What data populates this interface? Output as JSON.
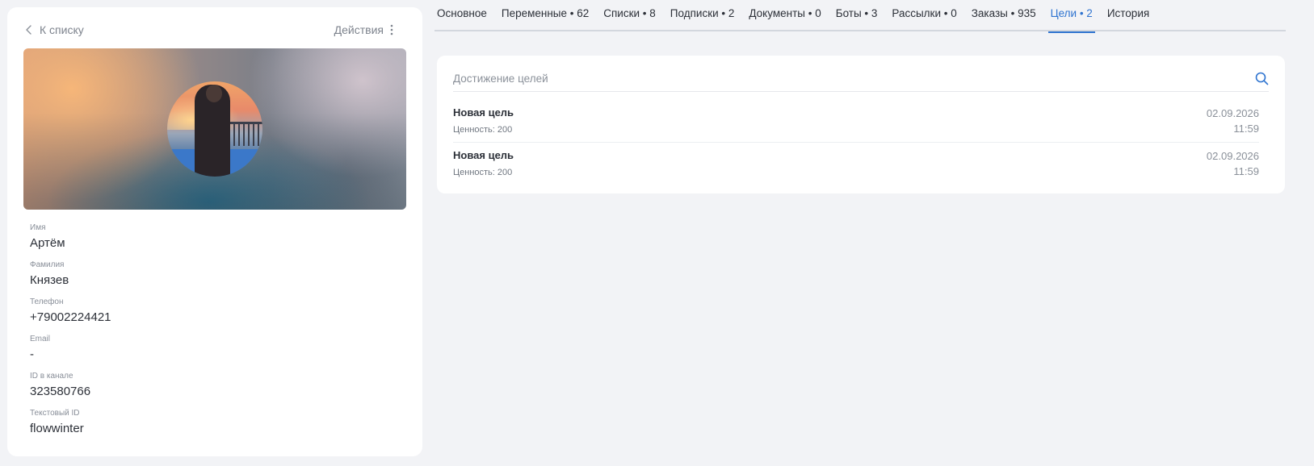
{
  "header": {
    "back_label": "К списку",
    "actions_label": "Действия"
  },
  "profile": {
    "fields": [
      {
        "label": "Имя",
        "value": "Артём"
      },
      {
        "label": "Фамилия",
        "value": "Князев"
      },
      {
        "label": "Телефон",
        "value": "+79002224421"
      },
      {
        "label": "Email",
        "value": "-"
      },
      {
        "label": "ID в канале",
        "value": "323580766"
      },
      {
        "label": "Текстовый ID",
        "value": "flowwinter"
      }
    ]
  },
  "tabs": [
    {
      "label": "Основное",
      "active": false
    },
    {
      "label": "Переменные • 62",
      "active": false
    },
    {
      "label": "Списки • 8",
      "active": false
    },
    {
      "label": "Подписки • 2",
      "active": false
    },
    {
      "label": "Документы • 0",
      "active": false
    },
    {
      "label": "Боты • 3",
      "active": false
    },
    {
      "label": "Рассылки • 0",
      "active": false
    },
    {
      "label": "Заказы • 935",
      "active": false
    },
    {
      "label": "Цели • 2",
      "active": true
    },
    {
      "label": "История",
      "active": false
    }
  ],
  "goals": {
    "search_placeholder": "Достижение целей",
    "items": [
      {
        "name": "Новая цель",
        "value": "Ценность: 200",
        "date": "02.09.2026",
        "time": "11:59"
      },
      {
        "name": "Новая цель",
        "value": "Ценность: 200",
        "date": "02.09.2026",
        "time": "11:59"
      }
    ]
  },
  "colors": {
    "accent": "#2f74d0",
    "background": "#f2f3f6",
    "card": "#ffffff"
  },
  "icons": {
    "back": "chevron-left-icon",
    "actions": "more-vertical-icon",
    "search": "search-icon"
  }
}
